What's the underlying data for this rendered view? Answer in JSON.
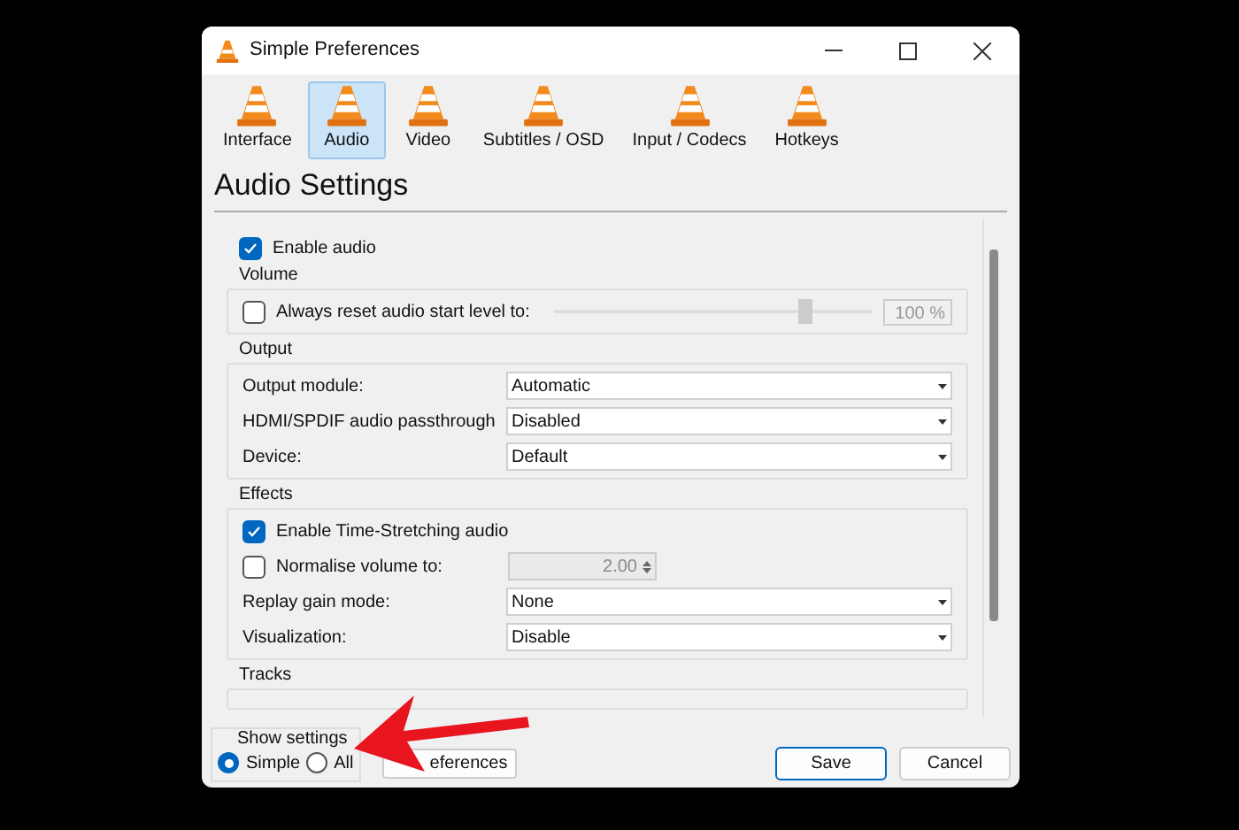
{
  "window": {
    "title": "Simple Preferences"
  },
  "tabs": [
    {
      "label": "Interface",
      "selected": false
    },
    {
      "label": "Audio",
      "selected": true
    },
    {
      "label": "Video",
      "selected": false
    },
    {
      "label": "Subtitles / OSD",
      "selected": false
    },
    {
      "label": "Input / Codecs",
      "selected": false
    },
    {
      "label": "Hotkeys",
      "selected": false
    }
  ],
  "heading": "Audio Settings",
  "enable_audio": {
    "label": "Enable audio",
    "checked": true
  },
  "sections": [
    {
      "title": "Volume",
      "rows": [
        {
          "kind": "slider",
          "label": "Always reset audio start level to:",
          "checked": false,
          "level": 0.8,
          "value": "100 %"
        }
      ]
    },
    {
      "title": "Output",
      "rows": [
        {
          "kind": "select",
          "label": "Output module:",
          "value": "Automatic"
        },
        {
          "kind": "select",
          "label": "HDMI/SPDIF audio passthrough",
          "value": "Disabled"
        },
        {
          "kind": "select",
          "label": "Device:",
          "value": "Default"
        }
      ]
    },
    {
      "title": "Effects",
      "rows": [
        {
          "kind": "checkbox",
          "label": "Enable Time-Stretching audio",
          "checked": true
        },
        {
          "kind": "spin",
          "label": "Normalise volume to:",
          "checked": false,
          "value": "2.00"
        },
        {
          "kind": "select",
          "label": "Replay gain mode:",
          "value": "None"
        },
        {
          "kind": "select",
          "label": "Visualization:",
          "value": "Disable"
        }
      ]
    },
    {
      "title": "Tracks"
    }
  ],
  "show_settings": {
    "title": "Show settings",
    "options": [
      {
        "label": "Simple",
        "selected": true
      },
      {
        "label": "All",
        "selected": false
      }
    ]
  },
  "reset_button": "eferences",
  "buttons": [
    "Save",
    "Cancel"
  ]
}
